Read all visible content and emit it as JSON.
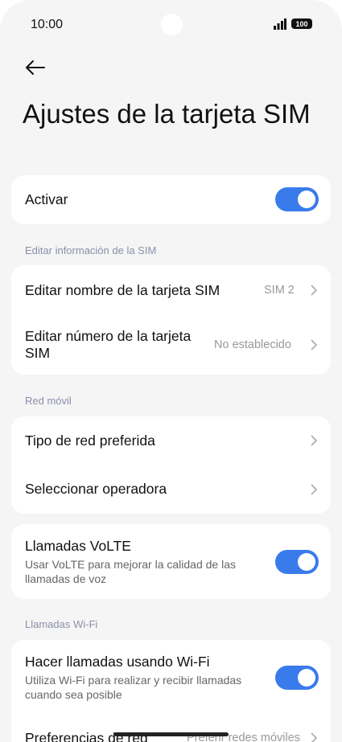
{
  "status_bar": {
    "time": "10:00",
    "battery": "100"
  },
  "page": {
    "title": "Ajustes de la tarjeta SIM"
  },
  "activate": {
    "label": "Activar",
    "enabled": true
  },
  "sections": {
    "sim_info": "Editar información de la SIM",
    "mobile_network": "Red móvil",
    "wifi_calls": "Llamadas Wi-Fi"
  },
  "sim_info": {
    "edit_name": {
      "label": "Editar nombre de la tarjeta SIM",
      "value": "SIM 2"
    },
    "edit_number": {
      "label": "Editar número de la tarjeta SIM",
      "value": "No establecido"
    }
  },
  "mobile_network": {
    "preferred_type": {
      "label": "Tipo de red preferida"
    },
    "select_operator": {
      "label": "Seleccionar operadora"
    }
  },
  "volte": {
    "label": "Llamadas VoLTE",
    "description": "Usar VoLTE para mejorar la calidad de las llamadas de voz",
    "enabled": true
  },
  "wifi_calls": {
    "make_calls": {
      "label": "Hacer llamadas usando Wi-Fi",
      "description": "Utiliza Wi-Fi para realizar y recibir llamadas cuando sea posible",
      "enabled": true
    },
    "preferences": {
      "label": "Preferencias de red",
      "value": "Preferir redes móviles"
    }
  },
  "colors": {
    "accent": "#3a7bec",
    "background": "#f5f5f5",
    "card": "#ffffff",
    "section_header": "#8a8fa8"
  }
}
